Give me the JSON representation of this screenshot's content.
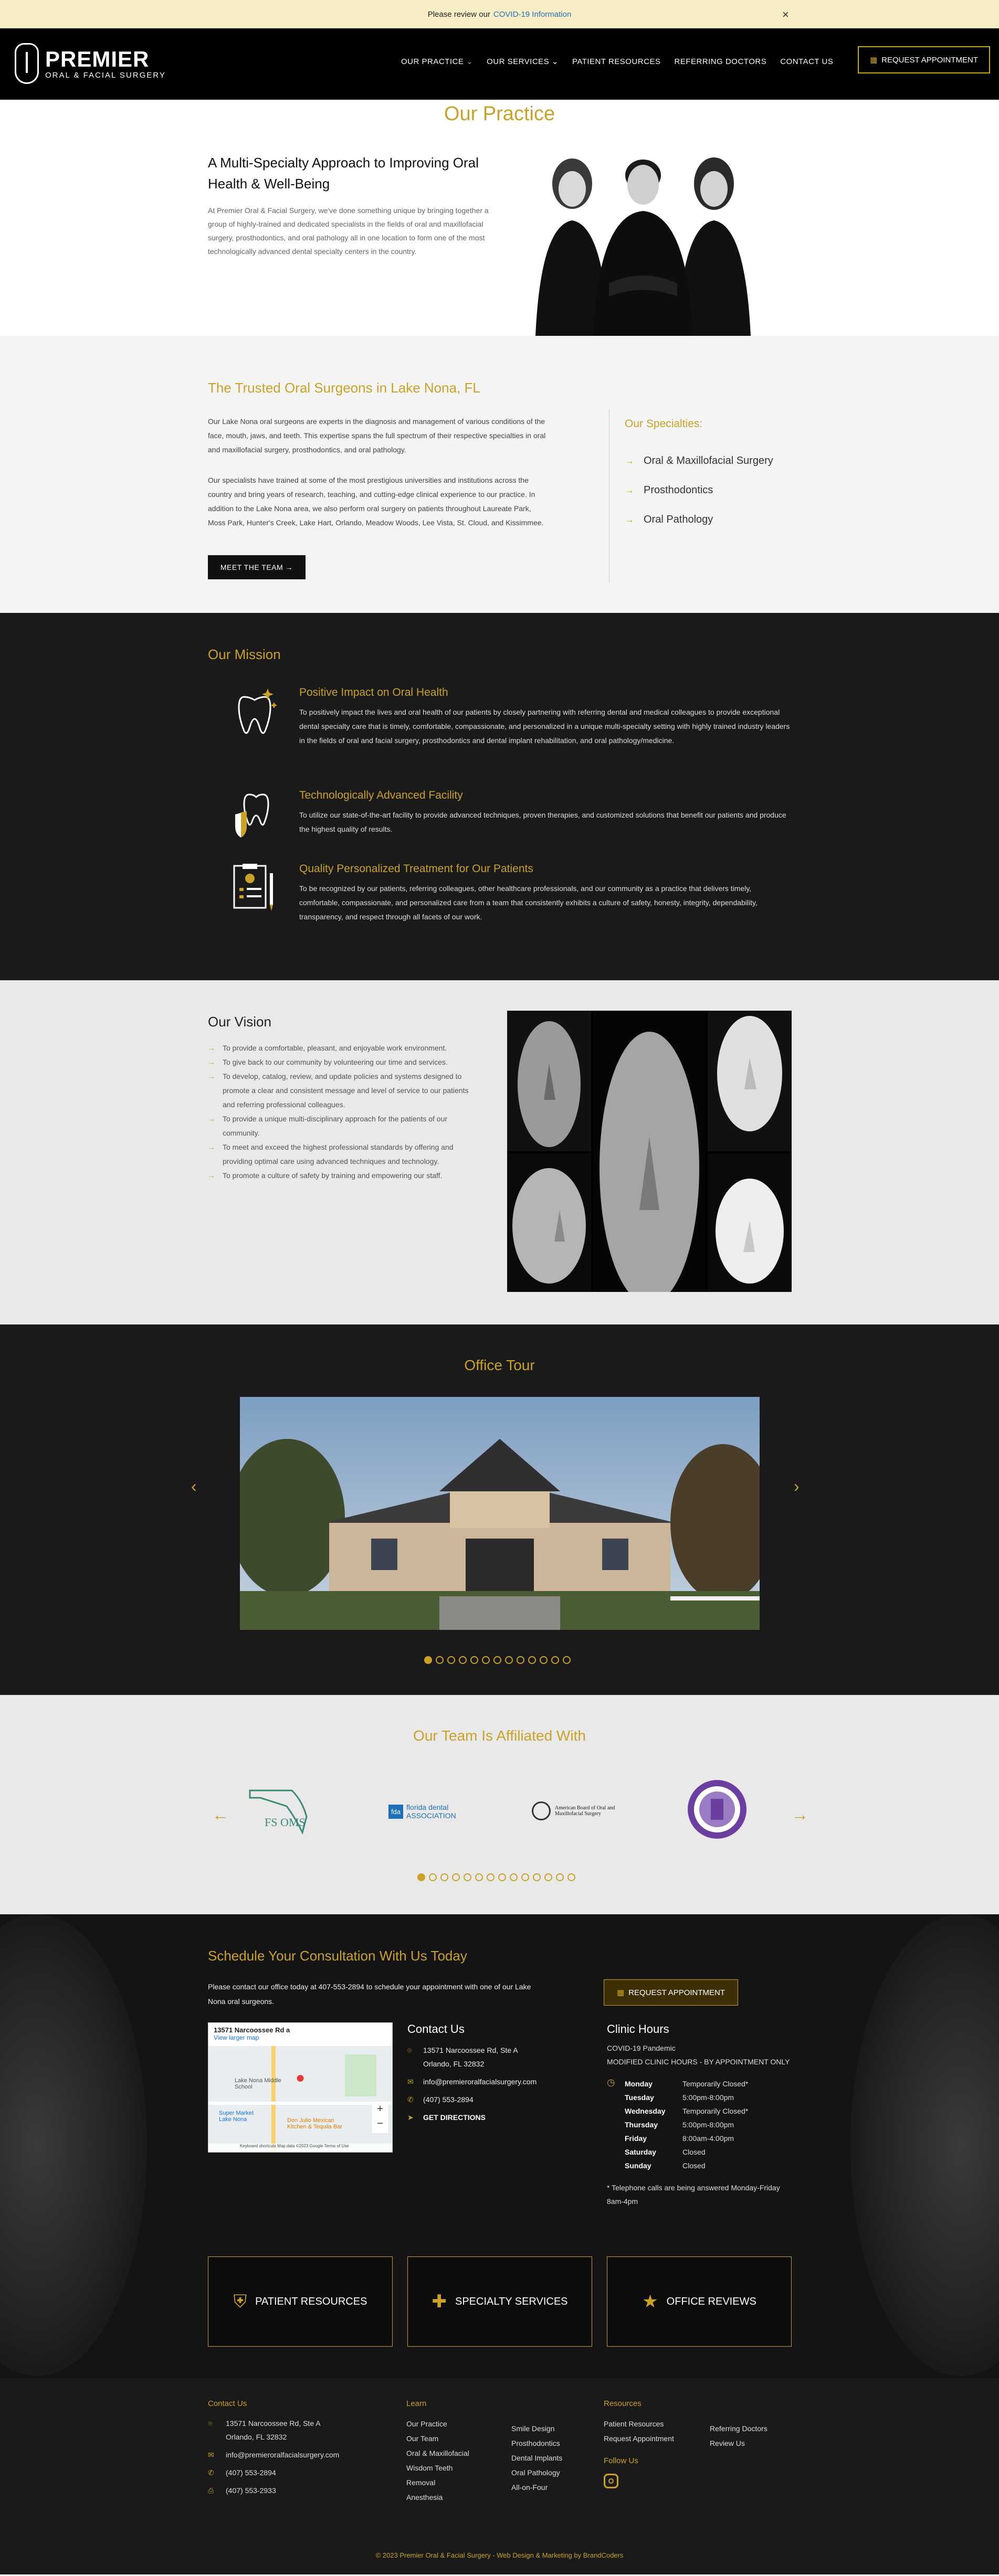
{
  "alert": {
    "text": "Please review our",
    "link": "COVID-19 Information",
    "close": "×"
  },
  "header": {
    "brand": "PREMIER",
    "sub": "ORAL & FACIAL SURGERY",
    "nav": [
      "OUR PRACTICE",
      "OUR SERVICES",
      "PATIENT RESOURCES",
      "REFERRING DOCTORS",
      "CONTACT US"
    ],
    "cta": "REQUEST APPOINTMENT"
  },
  "page_title": "Our Practice",
  "intro": {
    "heading": "A Multi-Specialty Approach to Improving Oral Health & Well-Being",
    "body": "At Premier Oral & Facial Surgery, we've done something unique by bringing together a group of highly-trained and dedicated specialists in the fields of oral and maxillofacial surgery, prosthodontics, and oral pathology all in one location to form one of the most technologically advanced dental specialty centers in the country."
  },
  "surgeons": {
    "heading": "The Trusted Oral Surgeons in Lake Nona, FL",
    "p1": "Our Lake Nona oral surgeons are experts in the diagnosis and management of various conditions of the face, mouth, jaws, and teeth. This expertise spans the full spectrum of their respective specialties in oral and maxillofacial surgery, prosthodontics, and oral pathology.",
    "p2": "Our specialists have trained at some of the most prestigious universities and institutions across the country and bring years of research, teaching, and cutting-edge clinical experience to our practice. In addition to the Lake Nona area, we also perform oral surgery on patients throughout Laureate Park, Moss Park, Hunter's Creek, Lake Hart, Orlando, Meadow Woods, Lee Vista, St. Cloud, and Kissimmee.",
    "button": "MEET THE TEAM →",
    "spec_title": "Our Specialties:",
    "specialties": [
      "Oral & Maxillofacial Surgery",
      "Prosthodontics",
      "Oral Pathology"
    ]
  },
  "mission": {
    "heading": "Our Mission",
    "items": [
      {
        "title": "Positive Impact on Oral Health",
        "text": "To positively impact the lives and oral health of our patients by closely partnering with referring dental and medical colleagues to provide exceptional dental specialty care that is timely, comfortable, compassionate, and personalized in a unique multi-specialty setting with highly trained industry leaders in the fields of oral and facial surgery, prosthodontics and dental implant rehabilitation, and oral pathology/medicine."
      },
      {
        "title": "Technologically Advanced Facility",
        "text": "To utilize our state-of-the-art facility to provide advanced techniques, proven therapies, and customized solutions that benefit our patients and produce the highest quality of results."
      },
      {
        "title": "Quality Personalized Treatment for Our Patients",
        "text": "To be recognized by our patients, referring colleagues, other healthcare professionals, and our community as a practice that delivers timely, comfortable, compassionate, and personalized care from a team that consistently exhibits a culture of safety, honesty, integrity, dependability, transparency, and respect through all facets of our work."
      }
    ]
  },
  "vision": {
    "heading": "Our Vision",
    "items": [
      "To provide a comfortable, pleasant, and enjoyable work environment.",
      "To give back to our community by volunteering our time and services.",
      "To develop, catalog, review, and update policies and systems designed to promote a clear and consistent message and level of service to our patients and referring professional colleagues.",
      "To provide a unique multi-disciplinary approach for the patients of our community.",
      "To meet and exceed the highest professional standards by offering and providing optimal care using advanced techniques and technology.",
      "To promote a culture of safety by training and empowering our staff."
    ]
  },
  "tour": {
    "heading": "Office Tour",
    "prev": "‹",
    "next": "›",
    "slide_count": 13,
    "active_slide": 0
  },
  "affiliations": {
    "heading": "Our Team Is Affiliated With",
    "prev": "←",
    "next": "→",
    "logos": [
      "FS OMS",
      "florida dental ASSOCIATION",
      "American Board of Oral and Maxillofacial Surgery",
      "Seal"
    ],
    "dot_count": 14,
    "active_dot": 0
  },
  "consult": {
    "heading": "Schedule Your Consultation With Us Today",
    "text": "Please contact our office today at 407-553-2894 to schedule your appointment with one of our Lake Nona oral surgeons.",
    "cta": "REQUEST APPOINTMENT",
    "map": {
      "title": "13571 Narcoossee Rd a",
      "link": "View larger map",
      "place1": "Lake Nona Middle School",
      "place2": "Super Market Lake Nona",
      "place3": "Don Julio Mexican Kitchen & Tequila Bar",
      "footer": "Keyboard shortcuts   Map data ©2023 Google   Terms of Use"
    },
    "contact": {
      "heading": "Contact Us",
      "addr1": "13571 Narcoossee Rd, Ste A",
      "addr2": "Orlando, FL 32832",
      "email": "info@premieroralfacialsurgery.com",
      "phone": "(407) 553-2894",
      "directions": "GET DIRECTIONS"
    },
    "hours": {
      "heading": "Clinic Hours",
      "note1": "COVID-19 Pandemic",
      "note2": "MODIFIED CLINIC HOURS - BY APPOINTMENT ONLY",
      "rows": [
        {
          "day": "Monday",
          "time": "Temporarily Closed*"
        },
        {
          "day": "Tuesday",
          "time": "5:00pm-8:00pm"
        },
        {
          "day": "Wednesday",
          "time": "Temporarily Closed*"
        },
        {
          "day": "Thursday",
          "time": "5:00pm-8:00pm"
        },
        {
          "day": "Friday",
          "time": "8:00am-4:00pm"
        },
        {
          "day": "Saturday",
          "time": "Closed"
        },
        {
          "day": "Sunday",
          "time": "Closed"
        }
      ],
      "footnote": "* Telephone calls are being answered Monday-Friday 8am-4pm"
    },
    "cards": [
      "PATIENT RESOURCES",
      "SPECIALTY SERVICES",
      "OFFICE REVIEWS"
    ]
  },
  "footer": {
    "contact": {
      "heading": "Contact Us",
      "addr1": "13571 Narcoossee Rd, Ste A",
      "addr2": "Orlando, FL 32832",
      "email": "info@premieroralfacialsurgery.com",
      "phone": "(407) 553-2894",
      "fax": "(407) 553-2933"
    },
    "learn": {
      "heading": "Learn",
      "col1": [
        "Our Practice",
        "Our Team",
        "Oral & Maxillofacial",
        "Wisdom Teeth",
        "Removal",
        "Anesthesia"
      ],
      "col2": [
        "Smile Design",
        "Prosthodontics",
        "Dental Implants",
        "Oral Pathology",
        "All-on-Four"
      ]
    },
    "resources": {
      "heading": "Resources",
      "col1": [
        "Patient Resources",
        "Request Appointment"
      ],
      "col2": [
        "Referring Doctors",
        "Review Us"
      ]
    },
    "follow": "Follow Us",
    "copyright": "© 2023 Premier Oral & Facial Surgery - Web Design & Marketing by BrandCoders"
  },
  "colors": {
    "accent": "#c9a227",
    "dark": "#1a1a1a",
    "light": "#e9e9e9"
  }
}
